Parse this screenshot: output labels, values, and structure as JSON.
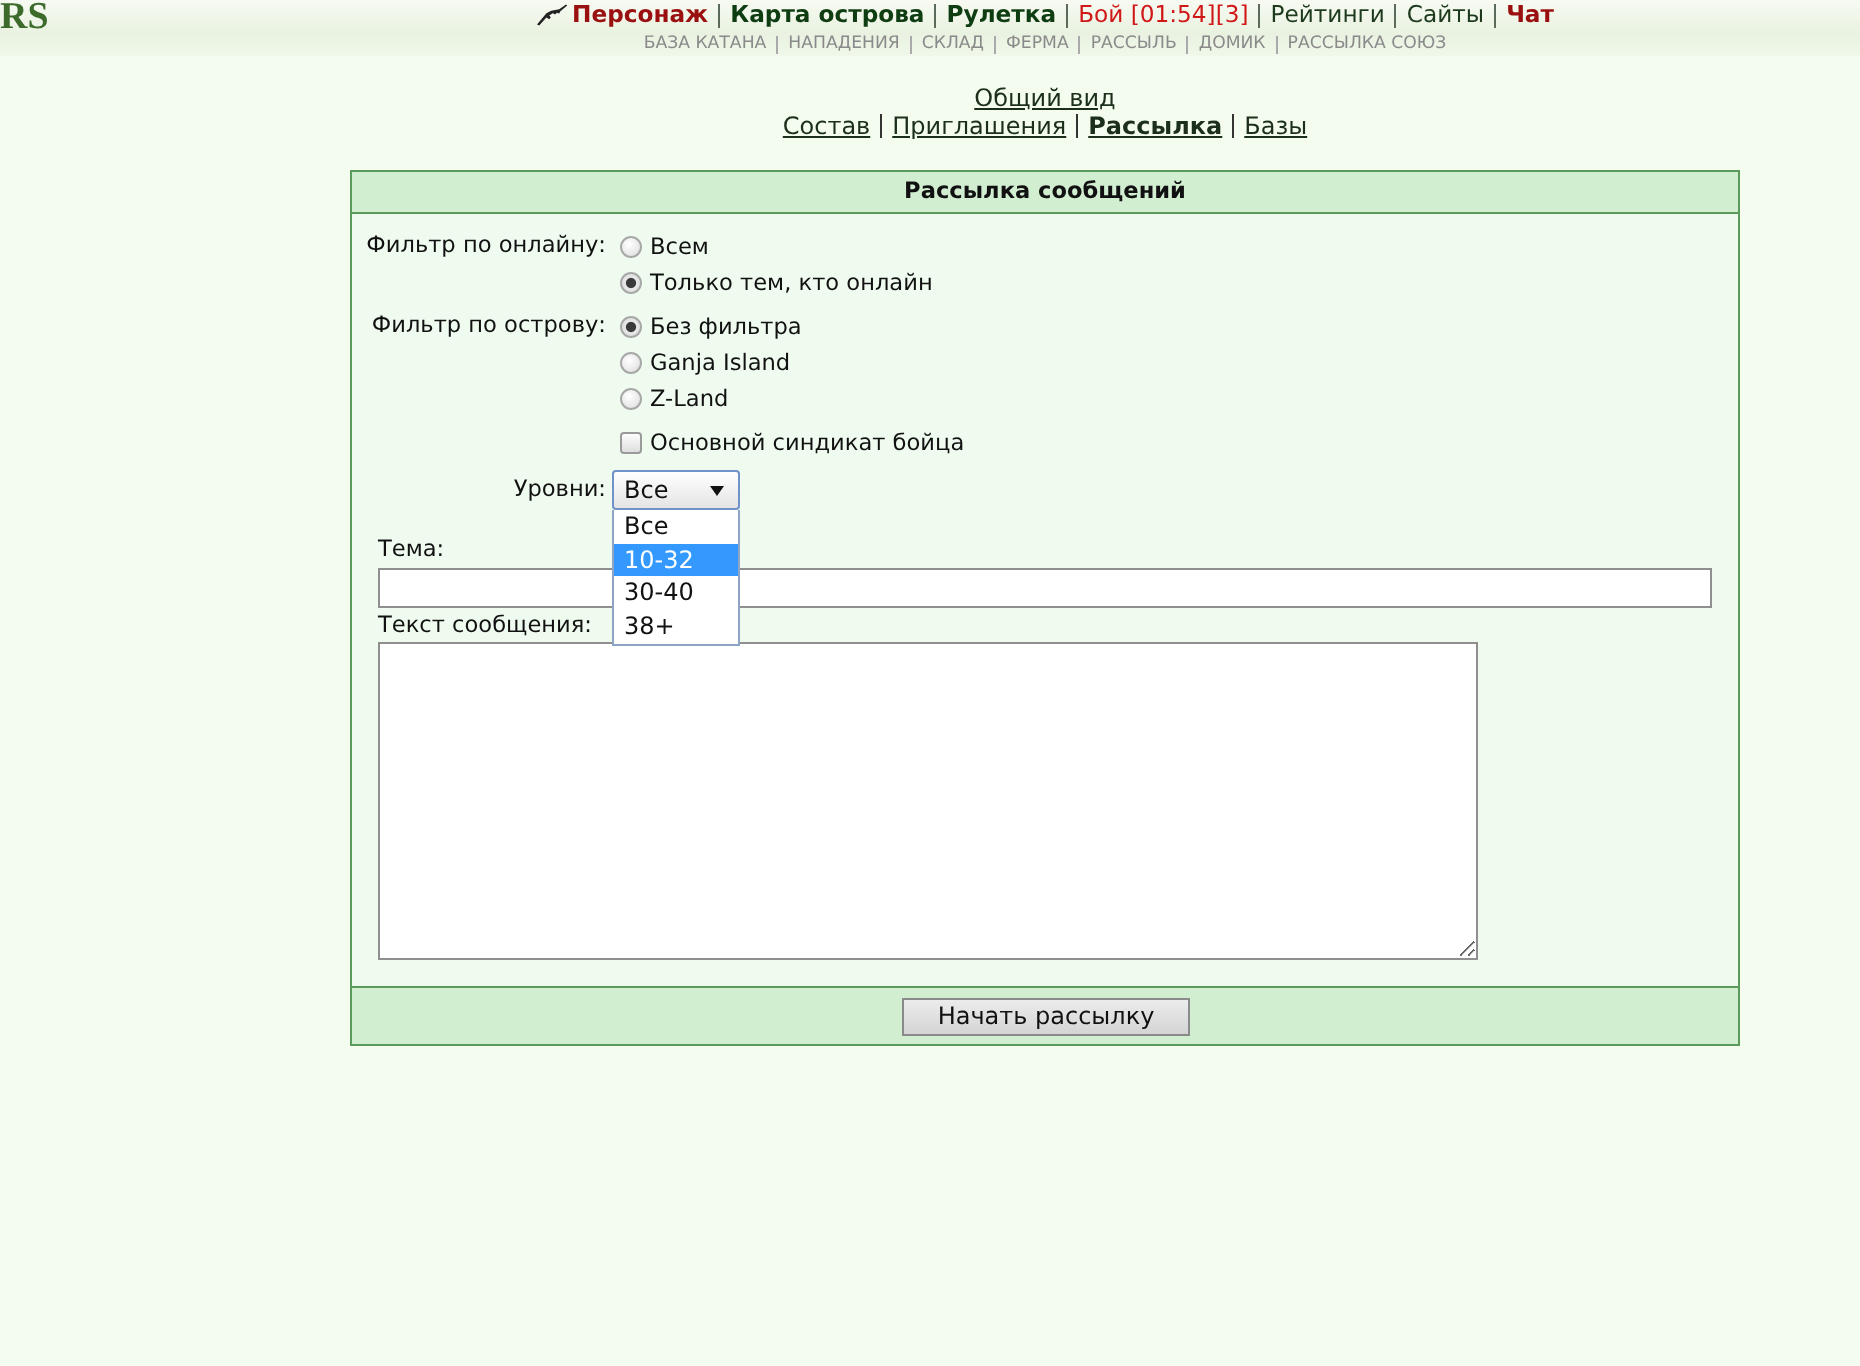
{
  "logo": {
    "text": "RS"
  },
  "top_nav": [
    {
      "label": "Персонаж",
      "kind": "accent"
    },
    {
      "label": "Карта острова",
      "kind": "main"
    },
    {
      "label": "Рулетка",
      "kind": "main"
    },
    {
      "label": "Бой [01:54][3]",
      "kind": "alert"
    },
    {
      "label": "Рейтинги",
      "kind": "plain"
    },
    {
      "label": "Сайты",
      "kind": "plain"
    },
    {
      "label": "Чат",
      "kind": "accent"
    }
  ],
  "sub_nav": [
    "БАЗА КАТАНА",
    "НАПАДЕНИЯ",
    "СКЛАД",
    "ФЕРМА",
    "РАССЫЛЬ",
    "ДОМИК",
    "РАССЫЛКА СОЮЗ"
  ],
  "section_nav": {
    "overview": "Общий вид",
    "tabs": [
      {
        "label": "Состав",
        "selected": false
      },
      {
        "label": "Приглашения",
        "selected": false
      },
      {
        "label": "Рассылка",
        "selected": true
      },
      {
        "label": "Базы",
        "selected": false
      }
    ]
  },
  "panel": {
    "title": "Рассылка сообщений",
    "filters": [
      {
        "label": "Фильтр по онлайну:",
        "options": [
          {
            "label": "Всем",
            "selected": false
          },
          {
            "label": "Только тем, кто онлайн",
            "selected": true
          }
        ]
      },
      {
        "label": "Фильтр по острову:",
        "options": [
          {
            "label": "Без фильтра",
            "selected": true
          },
          {
            "label": "Ganja Island",
            "selected": false
          },
          {
            "label": "Z-Land",
            "selected": false
          }
        ]
      }
    ],
    "syndicate_checkbox": {
      "label": "Основной синдикат бойца",
      "checked": false
    },
    "levels": {
      "label": "Уровни:",
      "value": "Все",
      "expanded": true,
      "options": [
        {
          "label": "Все",
          "highlighted": false
        },
        {
          "label": "10-32",
          "highlighted": true
        },
        {
          "label": "30-40",
          "highlighted": false
        },
        {
          "label": "38+",
          "highlighted": false
        }
      ]
    },
    "subject": {
      "label": "Тема:"
    },
    "message": {
      "label": "Текст сообщения:"
    },
    "submit": {
      "label": "Начать рассылку"
    }
  }
}
